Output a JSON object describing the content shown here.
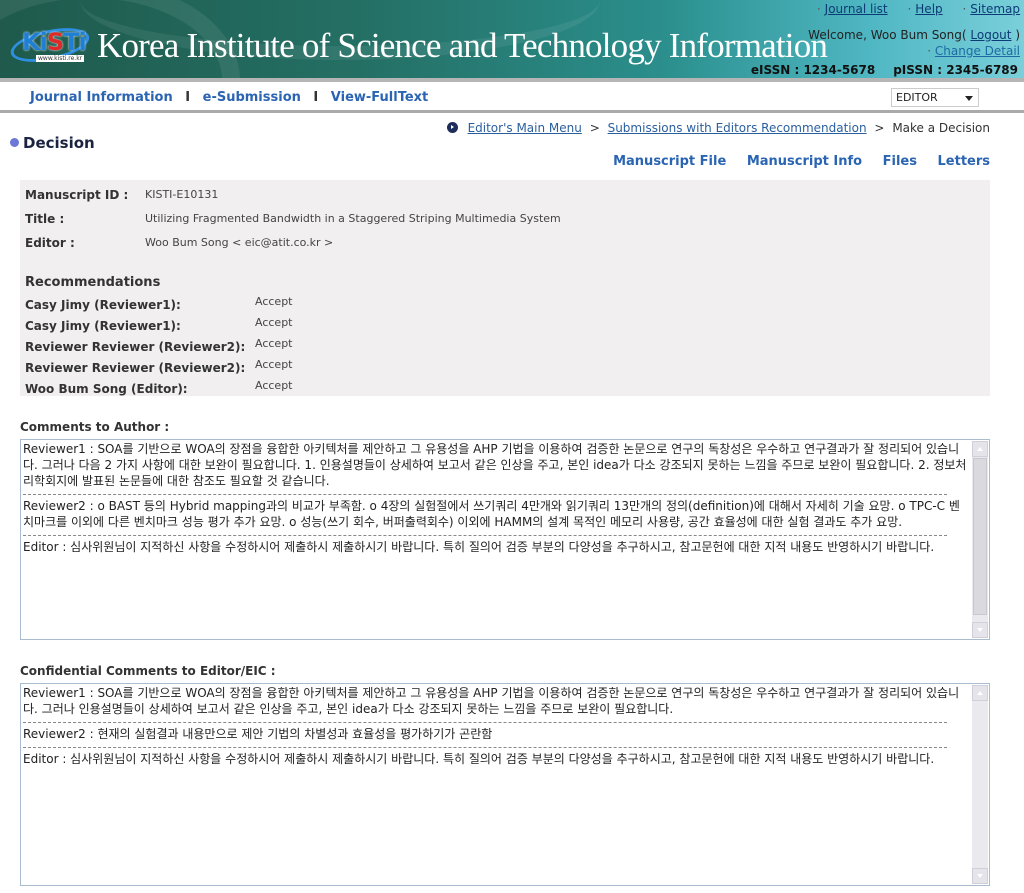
{
  "header": {
    "logo_text_prefix": "Ki",
    "logo_text_accent": "S",
    "logo_text_suffix": "Ti",
    "logo_url": "www.kisti.re.kr",
    "institute_name": "Korea Institute of  Science and Technology Information",
    "top_links": [
      {
        "label": "Journal list"
      },
      {
        "label": "Help"
      },
      {
        "label": "Sitemap"
      }
    ],
    "welcome_prefix": "Welcome, Woo Bum Song(",
    "logout_label": "Logout",
    "welcome_suffix": ")",
    "change_detail_label": "Change Detail",
    "eissn": "eISSN : 1234-5678",
    "pissn": "pISSN : 2345-6789"
  },
  "nav": {
    "items": [
      {
        "label": "Journal Information"
      },
      {
        "label": "e-Submission"
      },
      {
        "label": "View-FullText"
      }
    ],
    "separator": "I",
    "role_select": {
      "selected": "EDITOR"
    }
  },
  "breadcrumb": {
    "items": [
      {
        "label": "Editor's Main Menu"
      },
      {
        "label": "Submissions with Editors Recommendation"
      }
    ],
    "current": "Make a Decision",
    "separator": ">"
  },
  "page": {
    "title": "Decision",
    "tabs": [
      {
        "label": "Manuscript File"
      },
      {
        "label": "Manuscript Info"
      },
      {
        "label": "Files"
      },
      {
        "label": "Letters"
      }
    ]
  },
  "manuscript": {
    "id_label": "Manuscript ID :",
    "id_value": "KISTI-E10131",
    "title_label": "Title :",
    "title_value": "Utilizing Fragmented Bandwidth in a Staggered Striping Multimedia System",
    "editor_label": "Editor :",
    "editor_value": "Woo Bum Song < eic@atit.co.kr >"
  },
  "recommendations": {
    "heading": "Recommendations",
    "items": [
      {
        "name": "Casy Jimy (Reviewer1):",
        "decision": "Accept"
      },
      {
        "name": "Casy Jimy (Reviewer1):",
        "decision": "Accept"
      },
      {
        "name": "Reviewer Reviewer (Reviewer2):",
        "decision": "Accept"
      },
      {
        "name": "Reviewer Reviewer (Reviewer2):",
        "decision": "Accept"
      },
      {
        "name": "Woo Bum Song (Editor):",
        "decision": "Accept"
      }
    ]
  },
  "comments_to_author": {
    "label": "Comments to Author :",
    "entries": [
      "Reviewer1 :  SOA를 기반으로 WOA의 장점을 융합한 아키텍처를 제안하고 그 유용성을 AHP 기법을 이용하여 검증한 논문으로 연구의 독창성은 우수하고 연구결과가 잘 정리되어 있습니다. 그러나 다음 2 가지 사항에 대한 보완이 필요합니다. 1. 인용설명들이 상세하여 보고서 같은 인상을 주고, 본인 idea가 다소 강조되지 못하는 느낌을 주므로 보완이 필요합니다. 2. 정보처리학회지에 발표된 논문들에 대한 참조도 필요할 것 같습니다.",
      "Reviewer2 : o BAST 등의 Hybrid mapping과의 비교가 부족함. o 4장의 실험절에서 쓰기쿼리 4만개와 읽기쿼리 13만개의 정의(definition)에 대해서 자세히 기술 요망. o TPC-C 벤치마크를 이외에 다른 벤치마크 성능 평가 추가 요망. o 성능(쓰기 회수, 버퍼출력회수) 이외에 HAMM의 설계 목적인 메모리 사용량, 공간 효율성에 대한 실험 결과도 추가 요망.",
      "Editor : 심사위원님이 지적하신 사항을 수정하시어 제출하시 제출하시기 바랍니다. 특히 질의어 검증 부분의 다양성을 추구하시고, 참고문헌에 대한 지적 내용도 반영하시기 바랍니다."
    ]
  },
  "confidential_comments": {
    "label": "Confidential Comments to Editor/EIC :",
    "entries": [
      "Reviewer1 : SOA를 기반으로 WOA의 장점을 융합한 아키텍처를 제안하고 그 유용성을 AHP 기법을 이용하여 검증한 논문으로 연구의 독창성은 우수하고 연구결과가 잘 정리되어 있습니다. 그러나 인용설명들이 상세하여 보고서 같은 인상을 주고, 본인 idea가 다소 강조되지 못하는 느낌을 주므로 보완이 필요합니다.",
      "Reviewer2 : 현재의 실험결과 내용만으로 제안 기법의 차별성과 효율성을 평가하기가 곤란함",
      "Editor : 심사위원님이 지적하신 사항을 수정하시어 제출하시 제출하시기 바랍니다. 특히 질의어 검증 부분의 다양성을 추구하시고, 참고문헌에 대한 지적 내용도 반영하시기 바랍니다."
    ]
  }
}
